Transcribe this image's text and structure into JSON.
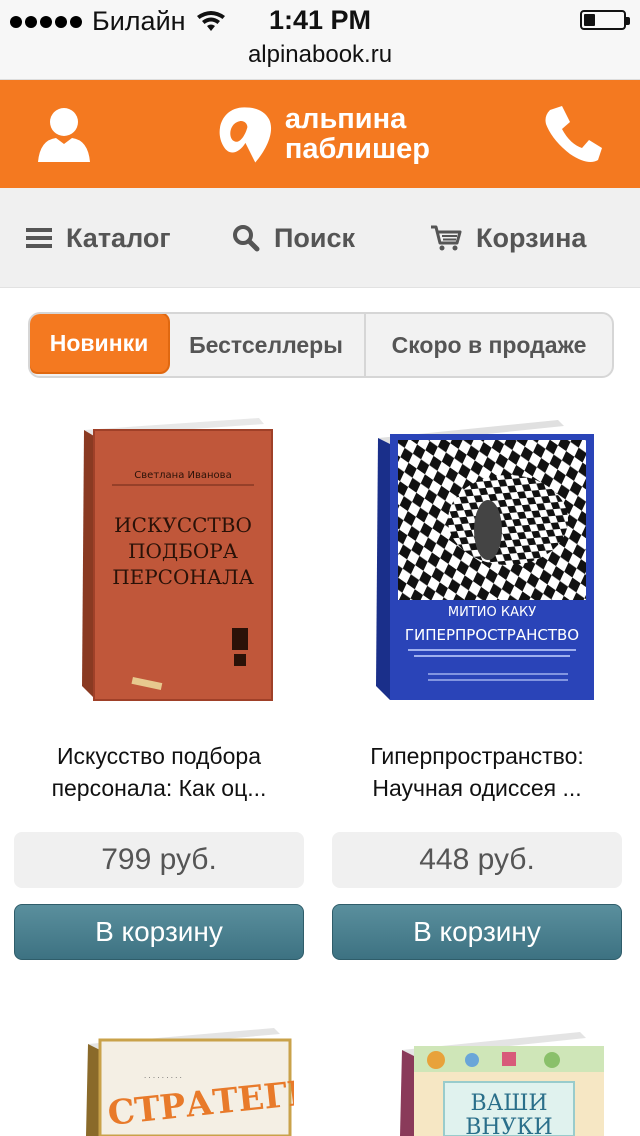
{
  "status_bar": {
    "carrier": "Билайн",
    "time": "1:41 PM",
    "battery_level": 0.3
  },
  "browser": {
    "url": "alpinabook.ru"
  },
  "header": {
    "logo_line1": "альпина",
    "logo_line2": "паблишер",
    "brand_color": "#f47920",
    "user_icon": "user-icon",
    "phone_icon": "phone-icon"
  },
  "nav": {
    "catalog": "Каталог",
    "search": "Поиск",
    "cart": "Корзина"
  },
  "tabs": {
    "new": "Новинки",
    "bestsellers": "Бестселлеры",
    "coming_soon": "Скоро в продаже",
    "active": "Новинки"
  },
  "products": [
    {
      "cover_author": "Светлана Иванова",
      "cover_title_1": "ИСКУССТВО",
      "cover_title_2": "ПОДБОРА",
      "cover_title_3": "ПЕРСОНАЛА",
      "title_line1": "Искусство подбора",
      "title_line2": "персонала: Как оц...",
      "price": "799 руб.",
      "button": "В корзину"
    },
    {
      "cover_author": "МИТИО КАКУ",
      "cover_title_1": "ГИПЕРПРОСТРАНСТВО",
      "title_line1": "Гиперпространство:",
      "title_line2": "Научная одиссея ...",
      "price": "448 руб.",
      "button": "В корзину"
    },
    {
      "cover_title_1": "СТРАТЕГИЯ"
    },
    {
      "cover_title_1": "ВАШИ",
      "cover_title_2": "ВНУКИ"
    }
  ]
}
